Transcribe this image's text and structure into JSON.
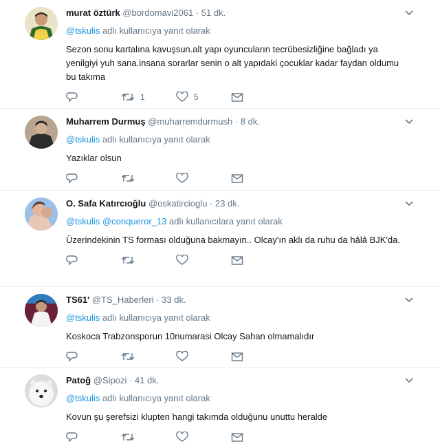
{
  "tweets": [
    {
      "name": "murat öztürk",
      "handle": "@bordomavi2061",
      "dot": "·",
      "time": "51 dk.",
      "reply_mentions": [
        "@tskulis"
      ],
      "reply_suffix": " adlı kullanıcıya yanıt olarak",
      "text": "Sezon sonu kartalına kavuşsun.alt yapı oyuncuların tecrübesizliğine bağladı ya yenilgiyi yuh sana.insana sorarlar senin o alt yapıdaki çocuklar kadar faydan oldumu bu takıma",
      "retweets": "1",
      "likes": "5",
      "avatar_colors": [
        "#f2d24a",
        "#2f6b2a"
      ]
    },
    {
      "name": "Muharrem Durmuş",
      "handle": "@muharremdurmush",
      "dot": "·",
      "time": "8 dk.",
      "reply_mentions": [
        "@tskulis"
      ],
      "reply_suffix": " adlı kullanıcıya yanıt olarak",
      "text": "Yazıklar olsun",
      "retweets": "",
      "likes": "",
      "avatar_colors": [
        "#3a3a3a",
        "#c9b6a2"
      ]
    },
    {
      "name": "O. Safa Katırcıoğlu",
      "handle": "@oskatircioglu",
      "dot": "·",
      "time": "23 dk.",
      "reply_mentions": [
        "@tskulis",
        "@conqueror_13"
      ],
      "reply_suffix": " adlı kullanıcılara yanıt olarak",
      "text": "Üzerindekinin TS forması olduğuna bakmayın.. Olcay'ın aklı da ruhu da hâlâ BJK'da.",
      "retweets": "",
      "likes": "",
      "avatar_colors": [
        "#7aa6d8",
        "#e8c7b7"
      ]
    },
    {
      "name": "TS61'",
      "handle": "@TS_Haberleri",
      "dot": "·",
      "time": "33 dk.",
      "reply_mentions": [
        "@tskulis"
      ],
      "reply_suffix": " adlı kullanıcıya yanıt olarak",
      "text": "Koskoca Trabzonsporun 10numarasi Olcay Sahan olmamalıdır",
      "retweets": "",
      "likes": "",
      "avatar_colors": [
        "#6a1f3a",
        "#f4f4f4"
      ]
    },
    {
      "name": "Patoğ",
      "handle": "@Sipozi",
      "dot": "·",
      "time": "41 dk.",
      "reply_mentions": [
        "@tskulis"
      ],
      "reply_suffix": " adlı kullanıcıya yanıt olarak",
      "text": "Kovun şu şerefsizi klupten hangi takımda olduğunu unuttu heralde",
      "retweets": "",
      "likes": "",
      "avatar_colors": [
        "#f2f2f2",
        "#222222"
      ]
    }
  ],
  "icons": {
    "reply": "reply-icon",
    "retweet": "retweet-icon",
    "like": "heart-icon",
    "dm": "envelope-icon",
    "more": "chevron-down-icon"
  },
  "colors": {
    "icon": "#657786",
    "link": "#1b95e0",
    "divider": "#e6ecf0",
    "text": "#14171a"
  }
}
